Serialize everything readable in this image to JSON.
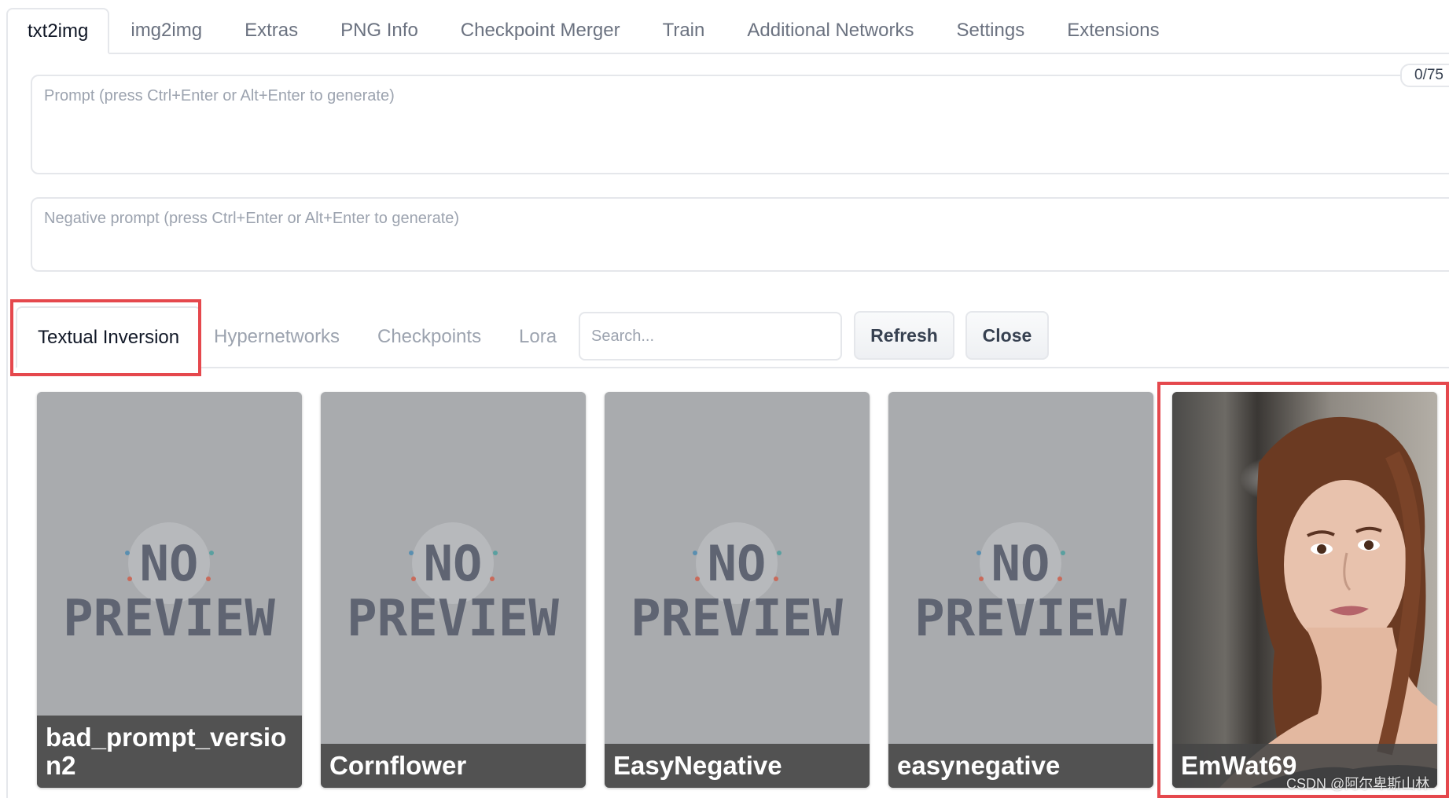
{
  "top_tabs": [
    {
      "label": "txt2img",
      "active": true
    },
    {
      "label": "img2img"
    },
    {
      "label": "Extras"
    },
    {
      "label": "PNG Info"
    },
    {
      "label": "Checkpoint Merger"
    },
    {
      "label": "Train"
    },
    {
      "label": "Additional Networks"
    },
    {
      "label": "Settings"
    },
    {
      "label": "Extensions"
    }
  ],
  "prompt": {
    "placeholder": "Prompt (press Ctrl+Enter or Alt+Enter to generate)",
    "value": "",
    "token_counter": "0/75"
  },
  "negative_prompt": {
    "placeholder": "Negative prompt (press Ctrl+Enter or Alt+Enter to generate)",
    "value": ""
  },
  "extra_networks": {
    "tabs": [
      {
        "label": "Textual Inversion",
        "active": true
      },
      {
        "label": "Hypernetworks"
      },
      {
        "label": "Checkpoints"
      },
      {
        "label": "Lora"
      }
    ],
    "search_placeholder": "Search...",
    "refresh_label": "Refresh",
    "close_label": "Close",
    "cards": [
      {
        "name": "bad_prompt_version2",
        "preview": "no-preview"
      },
      {
        "name": "Cornflower",
        "preview": "no-preview"
      },
      {
        "name": "EasyNegative",
        "preview": "no-preview"
      },
      {
        "name": "easynegative",
        "preview": "no-preview"
      },
      {
        "name": "EmWat69",
        "preview": "portrait-photo"
      }
    ],
    "no_preview_text": [
      "NO",
      "PREVIEW"
    ]
  },
  "watermark": "CSDN @阿尔卑斯山林",
  "colors": {
    "highlight": "#e5484d",
    "card_bg": "#a9abae",
    "name_bar": "#464646"
  }
}
